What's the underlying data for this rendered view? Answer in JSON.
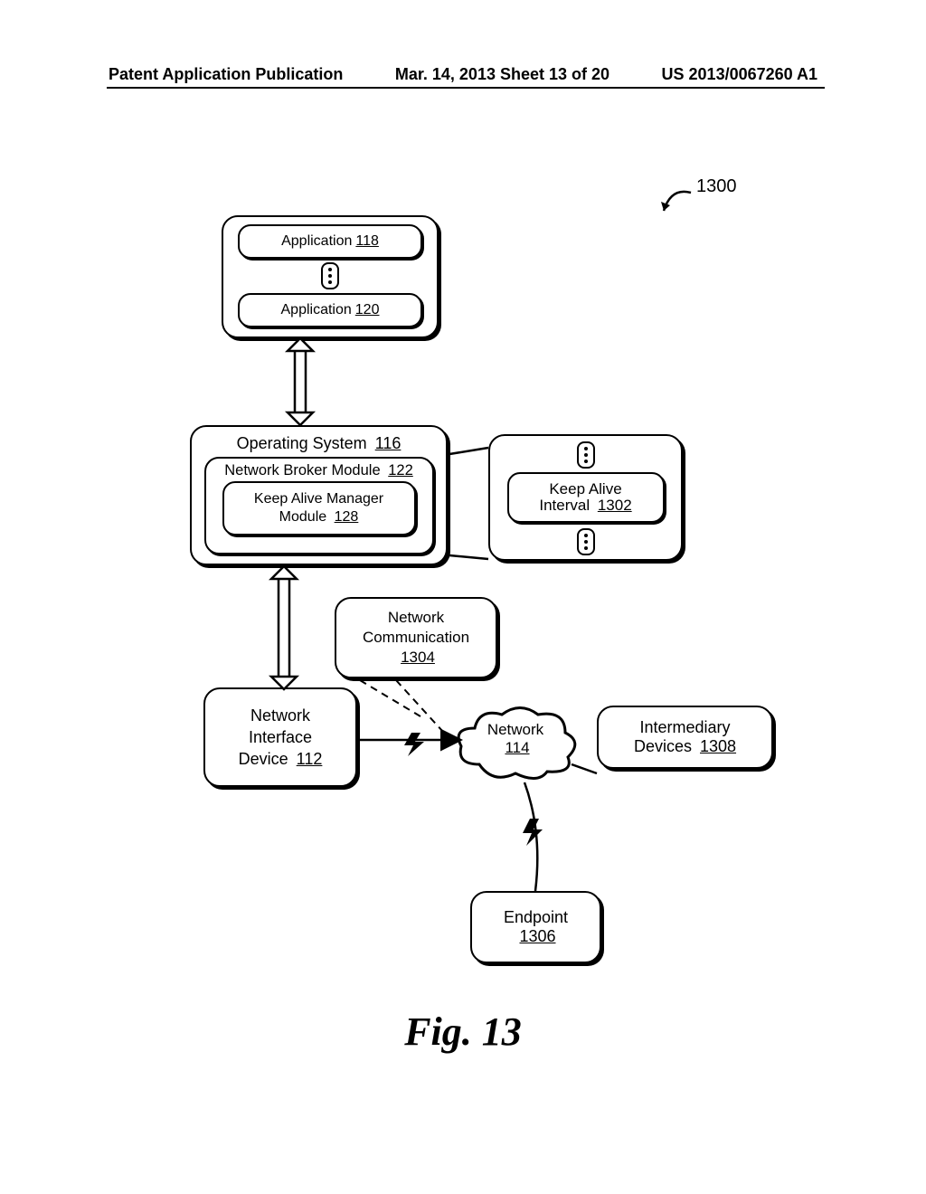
{
  "header": {
    "left": "Patent Application Publication",
    "center": "Mar. 14, 2013  Sheet 13 of 20",
    "right": "US 2013/0067260 A1"
  },
  "callout_1300": "1300",
  "apps": {
    "app1": {
      "label": "Application",
      "ref": "118"
    },
    "app2": {
      "label": "Application",
      "ref": "120"
    }
  },
  "os": {
    "title": "Operating System",
    "title_ref": "116",
    "nbm": {
      "label": "Network Broker Module",
      "ref": "122"
    },
    "kam": {
      "label_l1": "Keep Alive Manager",
      "label_l2": "Module",
      "ref": "128"
    }
  },
  "kai": {
    "label_l1": "Keep Alive",
    "label_l2": "Interval",
    "ref": "1302"
  },
  "netcomm": {
    "l1": "Network",
    "l2": "Communication",
    "ref": "1304"
  },
  "nid": {
    "l1": "Network",
    "l2": "Interface",
    "l3": "Device",
    "ref": "112"
  },
  "cloud": {
    "l1": "Network",
    "ref": "114"
  },
  "intdev": {
    "l1": "Intermediary",
    "l2": "Devices",
    "ref": "1308"
  },
  "endpoint": {
    "l1": "Endpoint",
    "ref": "1306"
  },
  "figure_label": "Fig. 13"
}
